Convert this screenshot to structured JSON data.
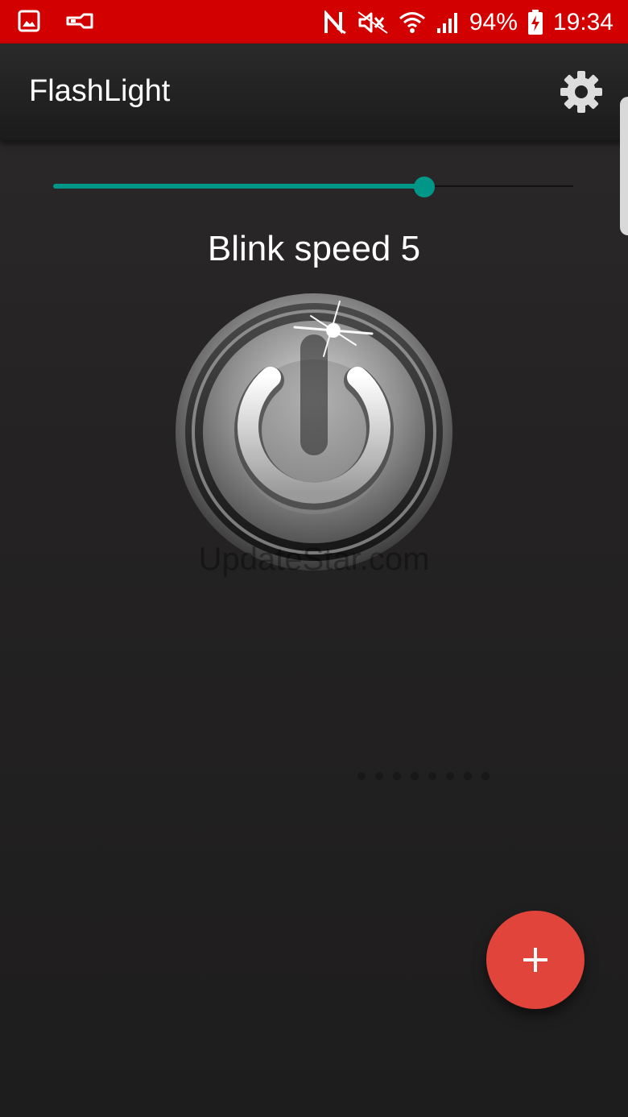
{
  "status_bar": {
    "icons": [
      "image-icon",
      "flashlight-icon",
      "nfc-icon",
      "mute-icon",
      "wifi-icon",
      "signal-icon",
      "battery-charging-icon"
    ],
    "battery": "94%",
    "time": "19:34",
    "color": "#d30000"
  },
  "app_bar": {
    "title": "FlashLight",
    "settings_icon": "gear-icon"
  },
  "slider": {
    "value": 5,
    "max": 7,
    "accent": "#009688"
  },
  "blink_label": "Blink speed 5",
  "power_button": {
    "icon": "power-icon"
  },
  "watermark": "UpdateStar.com",
  "fab": {
    "icon": "plus-icon",
    "color": "#e0443a"
  }
}
